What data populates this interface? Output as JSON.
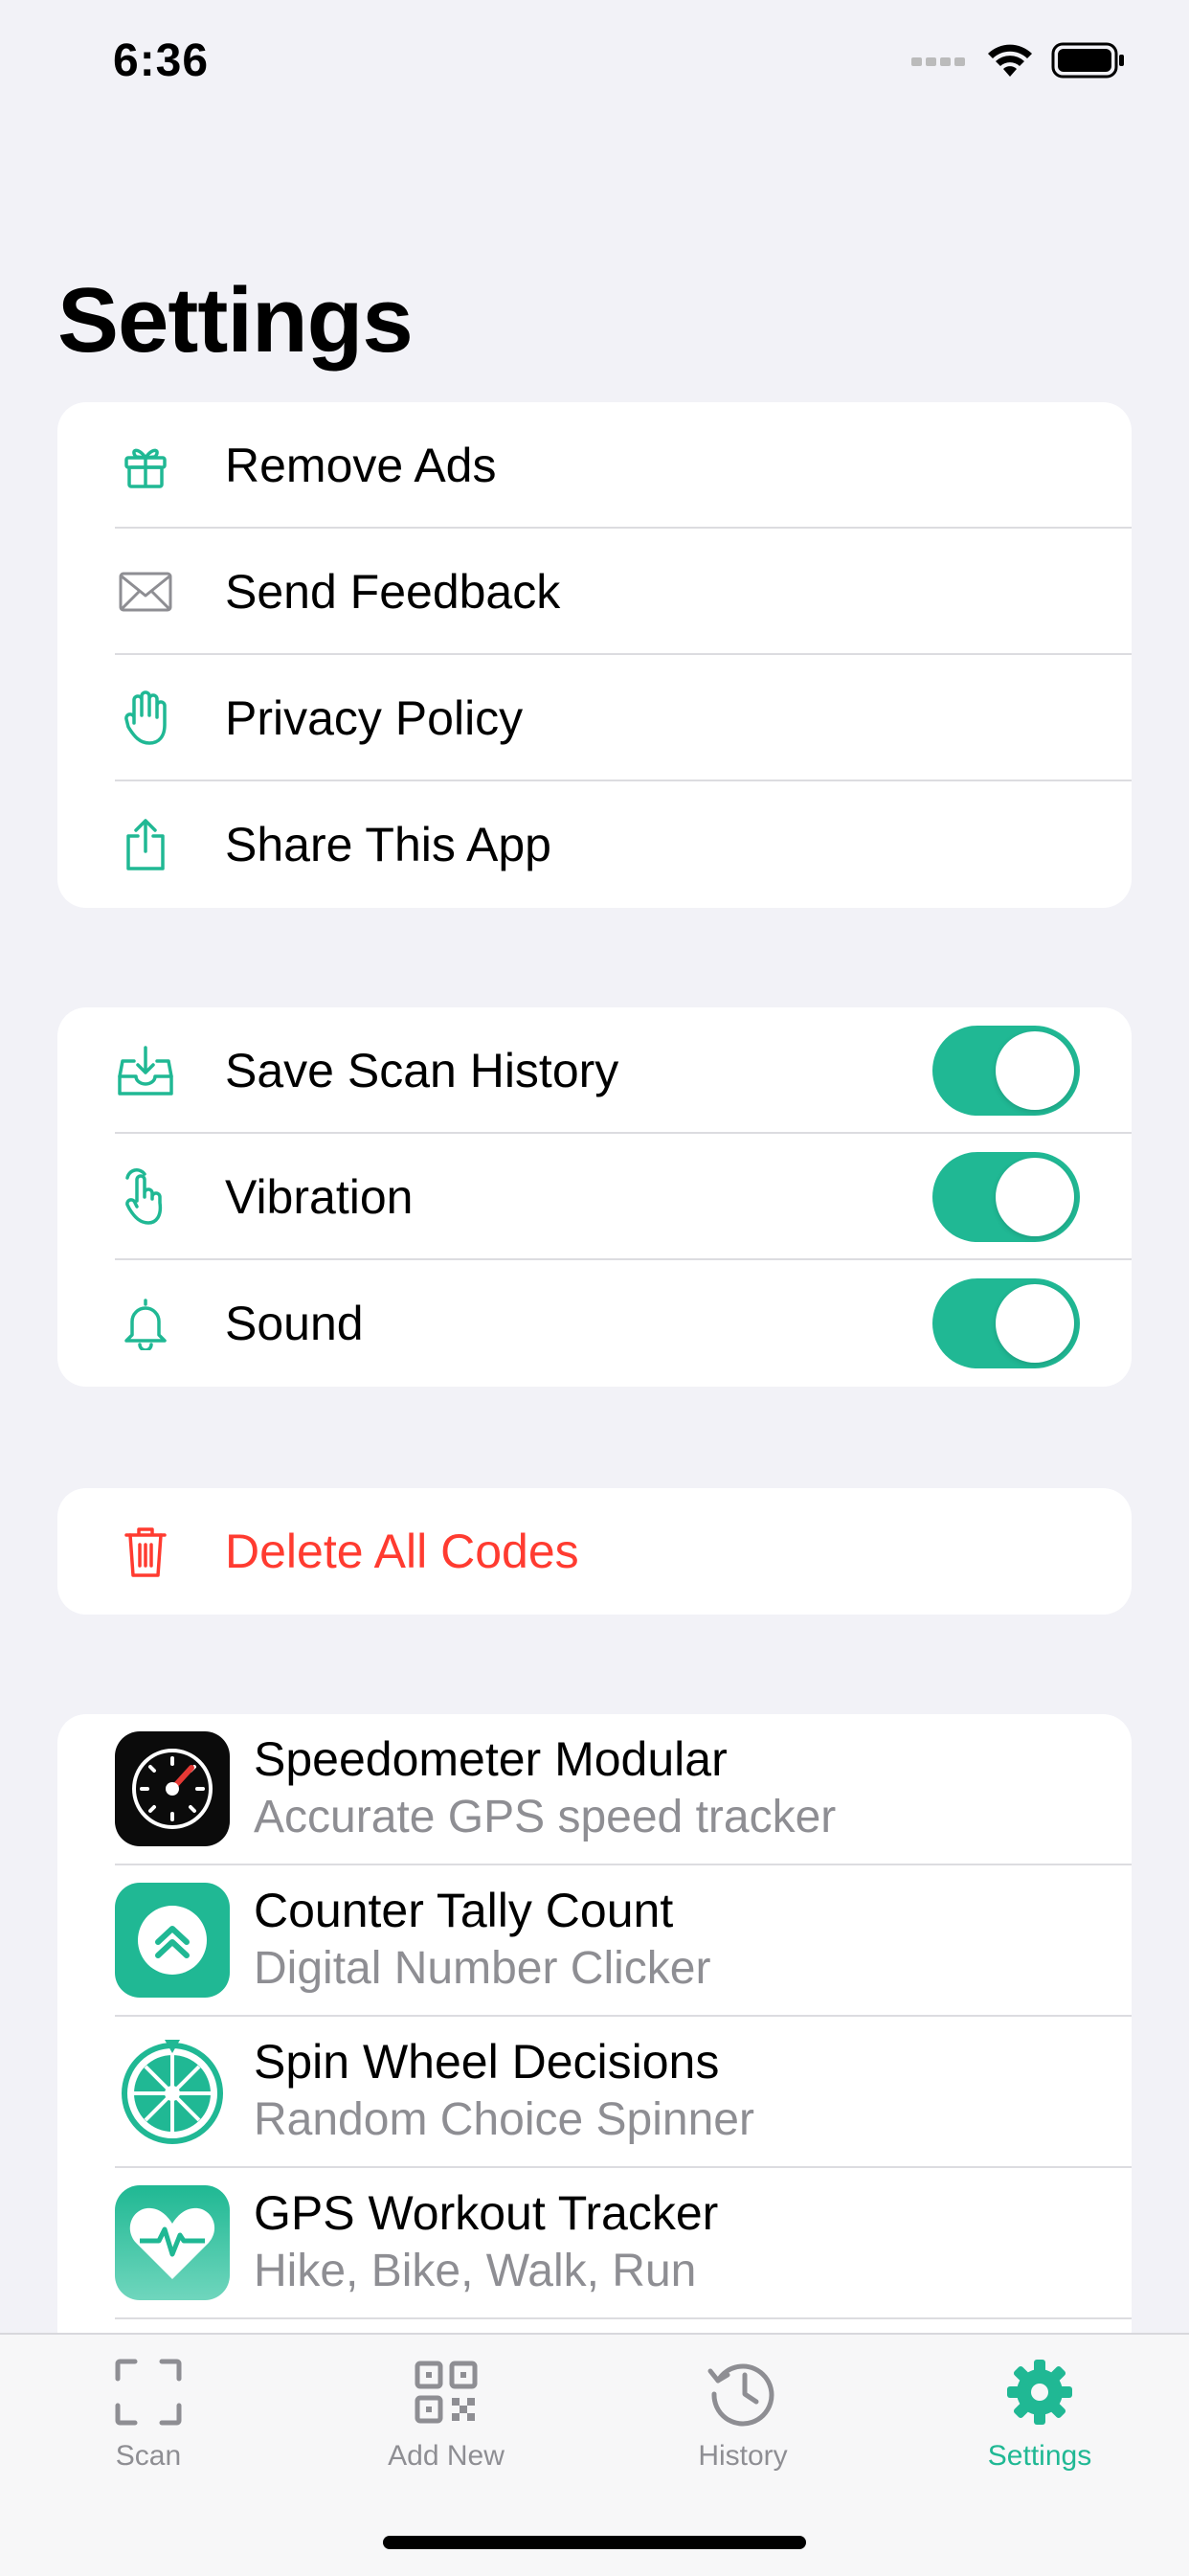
{
  "status_bar": {
    "time": "6:36"
  },
  "page_title": "Settings",
  "colors": {
    "accent": "#20b894",
    "destructive": "#ff3b30",
    "secondary_text": "#8e8e93"
  },
  "general": [
    {
      "label": "Remove Ads",
      "icon": "gift-icon"
    },
    {
      "label": "Send Feedback",
      "icon": "envelope-icon"
    },
    {
      "label": "Privacy Policy",
      "icon": "hand-icon"
    },
    {
      "label": "Share This App",
      "icon": "share-icon"
    }
  ],
  "toggles": [
    {
      "label": "Save Scan History",
      "icon": "tray-icon",
      "on": true
    },
    {
      "label": "Vibration",
      "icon": "tap-icon",
      "on": true
    },
    {
      "label": "Sound",
      "icon": "bell-icon",
      "on": true
    }
  ],
  "danger": {
    "label": "Delete All Codes",
    "icon": "trash-icon"
  },
  "apps": [
    {
      "title": "Speedometer Modular",
      "subtitle": "Accurate GPS speed tracker",
      "icon": "speedometer-icon"
    },
    {
      "title": "Counter Tally Count",
      "subtitle": "Digital Number Clicker",
      "icon": "counter-icon"
    },
    {
      "title": "Spin Wheel Decisions",
      "subtitle": "Random Choice Spinner",
      "icon": "wheel-icon"
    },
    {
      "title": "GPS Workout Tracker",
      "subtitle": "Hike, Bike, Walk, Run",
      "icon": "heart-icon"
    }
  ],
  "tabbar": [
    {
      "label": "Scan",
      "icon": "scan-icon",
      "selected": false
    },
    {
      "label": "Add New",
      "icon": "qr-icon",
      "selected": false
    },
    {
      "label": "History",
      "icon": "history-icon",
      "selected": false
    },
    {
      "label": "Settings",
      "icon": "gear-icon",
      "selected": true
    }
  ]
}
